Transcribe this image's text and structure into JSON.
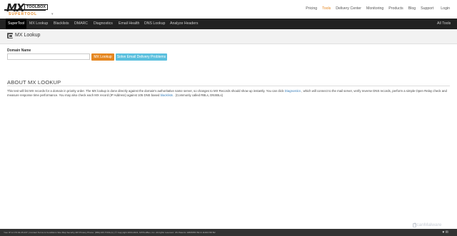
{
  "brand": {
    "logo_text": "MX",
    "logo_box": "TOOLBOX",
    "logo_sub": "SUPERTOOL",
    "caret": "▾"
  },
  "top_nav": [
    {
      "label": "Pricing",
      "active": false
    },
    {
      "label": "Tools",
      "active": true
    },
    {
      "label": "Delivery Center",
      "active": false
    },
    {
      "label": "Monitoring",
      "active": false
    },
    {
      "label": "Products",
      "active": false
    },
    {
      "label": "Blog",
      "active": false
    },
    {
      "label": "Support",
      "active": false
    }
  ],
  "login_label": "Login",
  "main_nav": [
    {
      "label": "SuperTool",
      "active": true
    },
    {
      "label": "MX Lookup",
      "active": false
    },
    {
      "label": "Blacklists",
      "active": false
    },
    {
      "label": "DMARC",
      "active": false
    },
    {
      "label": "Diagnostics",
      "active": false
    },
    {
      "label": "Email Health",
      "active": false
    },
    {
      "label": "DNS Lookup",
      "active": false
    },
    {
      "label": "Analyze Headers",
      "active": false
    }
  ],
  "all_tools_label": "All Tools",
  "page_title": "MX Lookup",
  "form": {
    "domain_label": "Domain Name",
    "domain_value": "",
    "mx_button": "MX Lookup",
    "solve_button": "Solve Email Delivery Problems"
  },
  "about": {
    "title": "ABOUT MX LOOKUP",
    "text_1": "This test will list MX records for a domain in priority order. The MX lookup is done directly against the domain's authoritative name server, so changes to MX Records should show up instantly. You can click ",
    "link_diagnostics": "Diagnostics",
    "text_2": " , which will connect to the mail server, verify reverse DNS records, perform a simple Open Relay check and measure response time performance. You may also check each MX record (IP Address) against 105 DNS based ",
    "link_blacklists": "blacklists",
    "text_3": " . (Commonly called RBLs, DNSBLs)"
  },
  "watermark": "ScanMalware",
  "footer": {
    "text": "Your IP is 170.64.26.237 | Contact Terms & Conditions Site Map Security API Privacy Phone: (866)-MX-TOOL(1) | © Copyright 2004-2021, MXToolBox, Inc. All rights reserved. US Patents 10839353 B2 & 11461738 B2",
    "icons": "♥ ✉"
  },
  "colors": {
    "accent_orange": "#e5861f",
    "button_blue": "#5bc0de",
    "nav_dark": "#222222",
    "link_blue": "#337ab7"
  }
}
